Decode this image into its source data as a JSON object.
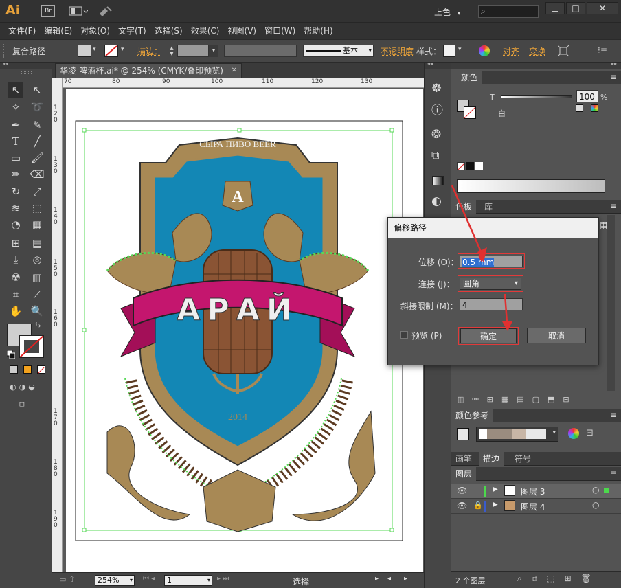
{
  "app": {
    "logo": "Ai",
    "bridge": "Br",
    "workspace": "上色",
    "search_placeholder": ""
  },
  "menu": [
    "文件(F)",
    "编辑(E)",
    "对象(O)",
    "文字(T)",
    "选择(S)",
    "效果(C)",
    "视图(V)",
    "窗口(W)",
    "帮助(H)"
  ],
  "control": {
    "selection_type": "复合路径",
    "stroke_label": "描边：",
    "brush_label": "基本",
    "opacity_label": "不透明度",
    "style_label": "样式：",
    "align_label": "对齐",
    "transform_label": "变换"
  },
  "document": {
    "tab_title": "华凌-啤酒杯.ai* @ 254% (CMYK/叠印预览)"
  },
  "ruler": {
    "h_ticks": [
      "70",
      "80",
      "90",
      "100",
      "110",
      "120",
      "130"
    ],
    "v_ticks": [
      "1 2 0",
      "1 3 0",
      "1 4 0",
      "1 5 0",
      "1 6 0",
      "1 7 0",
      "1 8 0",
      "1 9 0"
    ]
  },
  "artwork": {
    "banner_top": "СЫРА ПИВО BEER",
    "crest_letter": "A",
    "main_title": "АРАЙ",
    "year": "2014",
    "accent_colors": {
      "gold": "#a88955",
      "blue": "#1387b5",
      "magenta": "#c4166e",
      "barrel": "#8a5434"
    }
  },
  "statusbar": {
    "zoom": "254%",
    "page": "1",
    "mode": "选择"
  },
  "color_panel": {
    "tab": "颜色",
    "t_label": "T",
    "white_label": "白",
    "value": "100",
    "unit": "%"
  },
  "swatches_panel": {
    "tab1": "色板",
    "tab2": "库"
  },
  "color_guide": {
    "tab": "颜色参考"
  },
  "stroke_tabs": [
    "画笔",
    "描边",
    "符号"
  ],
  "layers": {
    "tab": "图层",
    "rows": [
      {
        "name": "图层 3",
        "color": "#4cd94c"
      },
      {
        "name": "图层 4",
        "color": "#3a5bcc"
      }
    ],
    "count": "2 个图层"
  },
  "dialog": {
    "title": "偏移路径",
    "offset_label": "位移 (O)：",
    "offset_value": "0.5 mm",
    "join_label": "连接 (J)：",
    "join_value": "圆角",
    "miter_label": "斜接限制 (M)：",
    "miter_value": "4",
    "preview_label": "预览 (P)",
    "ok_label": "确定",
    "cancel_label": "取消"
  }
}
